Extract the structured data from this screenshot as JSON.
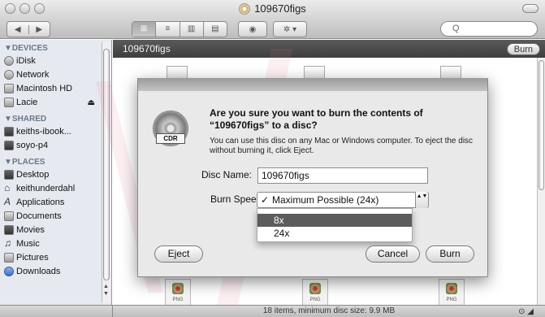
{
  "window": {
    "title": "109670figs"
  },
  "toolbar": {
    "back": "◀",
    "forward": "▶",
    "view_icon": "⊞",
    "view_list": "≡",
    "view_columns": "▥",
    "view_coverflow": "▤",
    "quicklook": "◉",
    "action": "✲ ▾",
    "search_glyph": "Q"
  },
  "sidebar": {
    "devices_label": "▼DEVICES",
    "devices": [
      {
        "label": "iDisk"
      },
      {
        "label": "Network"
      },
      {
        "label": "Macintosh HD"
      },
      {
        "label": "Lacie"
      }
    ],
    "eject_glyph": "⏏",
    "shared_label": "▼SHARED",
    "shared": [
      {
        "label": "keiths-ibook..."
      },
      {
        "label": "soyo-p4"
      }
    ],
    "places_label": "▼PLACES",
    "places": [
      {
        "label": "Desktop"
      },
      {
        "label": "keithunderdahl"
      },
      {
        "label": "Applications"
      },
      {
        "label": "Documents"
      },
      {
        "label": "Movies"
      },
      {
        "label": "Music"
      },
      {
        "label": "Pictures"
      },
      {
        "label": "Downloads"
      }
    ],
    "icons": {
      "home": "⌂",
      "apps": "A",
      "music": "♫"
    }
  },
  "pathbar": {
    "folder": "109670figs",
    "burn_button": "Burn"
  },
  "file_label": "PNG",
  "status": {
    "text": "18 items, minimum disc size: 9.9 MB",
    "resize": "⊙ ◢"
  },
  "dialog": {
    "cd_label": "CDR",
    "headline": "Are you sure you want to burn the contents of “109670figs” to a disc?",
    "subtext": "You can use this disc on any Mac or Windows computer. To eject the disc without burning it, click Eject.",
    "disc_name_label": "Disc Name:",
    "disc_name_value": "109670figs",
    "burn_speed_label": "Burn Spee",
    "burn_speed_selected": "Maximum Possible (24x)",
    "check": "✓",
    "popup_arrows": "▲▼",
    "menu_options": [
      "8x",
      "24x"
    ],
    "eject_button": "Eject",
    "cancel_button": "Cancel",
    "burn_button": "Burn"
  }
}
